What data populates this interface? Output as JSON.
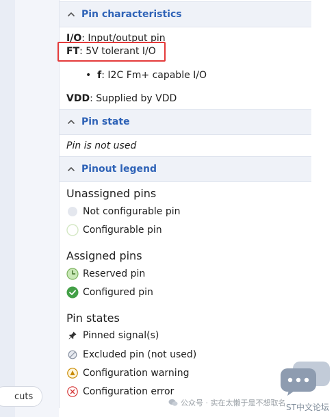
{
  "sections": {
    "pin_characteristics": {
      "title": "Pin characteristics"
    },
    "pin_state": {
      "title": "Pin state"
    },
    "pinout_legend": {
      "title": "Pinout legend"
    }
  },
  "characteristics": {
    "io_key": "I/O",
    "io_text": ": Input/output pin",
    "ft_key": "FT",
    "ft_text": ": 5V tolerant I/O",
    "f_key": "f",
    "f_text": ": I2C Fm+ capable I/O",
    "vdd_key": "VDD",
    "vdd_text": ": Supplied by VDD"
  },
  "pin_state": {
    "text": "Pin is not used"
  },
  "legend": {
    "unassigned_title": "Unassigned pins",
    "unassigned_items": [
      "Not configurable pin",
      "Configurable pin"
    ],
    "assigned_title": "Assigned pins",
    "assigned_items": [
      "Reserved pin",
      "Configured pin"
    ],
    "states_title": "Pin states",
    "states_items": [
      "Pinned signal(s)",
      "Excluded pin (not used)",
      "Configuration warning",
      "Configuration error"
    ]
  },
  "shortcuts": {
    "label": "cuts"
  },
  "watermark": {
    "text": "公众号 · 实在太懒于是不想取名",
    "brand": "ST中文论坛"
  },
  "colors": {
    "accent": "#2f63b7",
    "header_bg": "#eff2f8",
    "highlight": "#e43a3a",
    "configured": "#43a047",
    "reserved_fill": "#c9e8b7",
    "warning": "#c98a00",
    "error": "#d63a3a"
  },
  "icons": {
    "chevron": "chevron-up-icon",
    "not_configurable": "gray-dot-icon",
    "configurable": "empty-circle-icon",
    "reserved": "clock-icon",
    "configured": "check-circle-icon",
    "pinned": "pin-icon",
    "excluded": "forbidden-icon",
    "warning": "warning-triangle-icon",
    "error": "error-x-icon"
  }
}
